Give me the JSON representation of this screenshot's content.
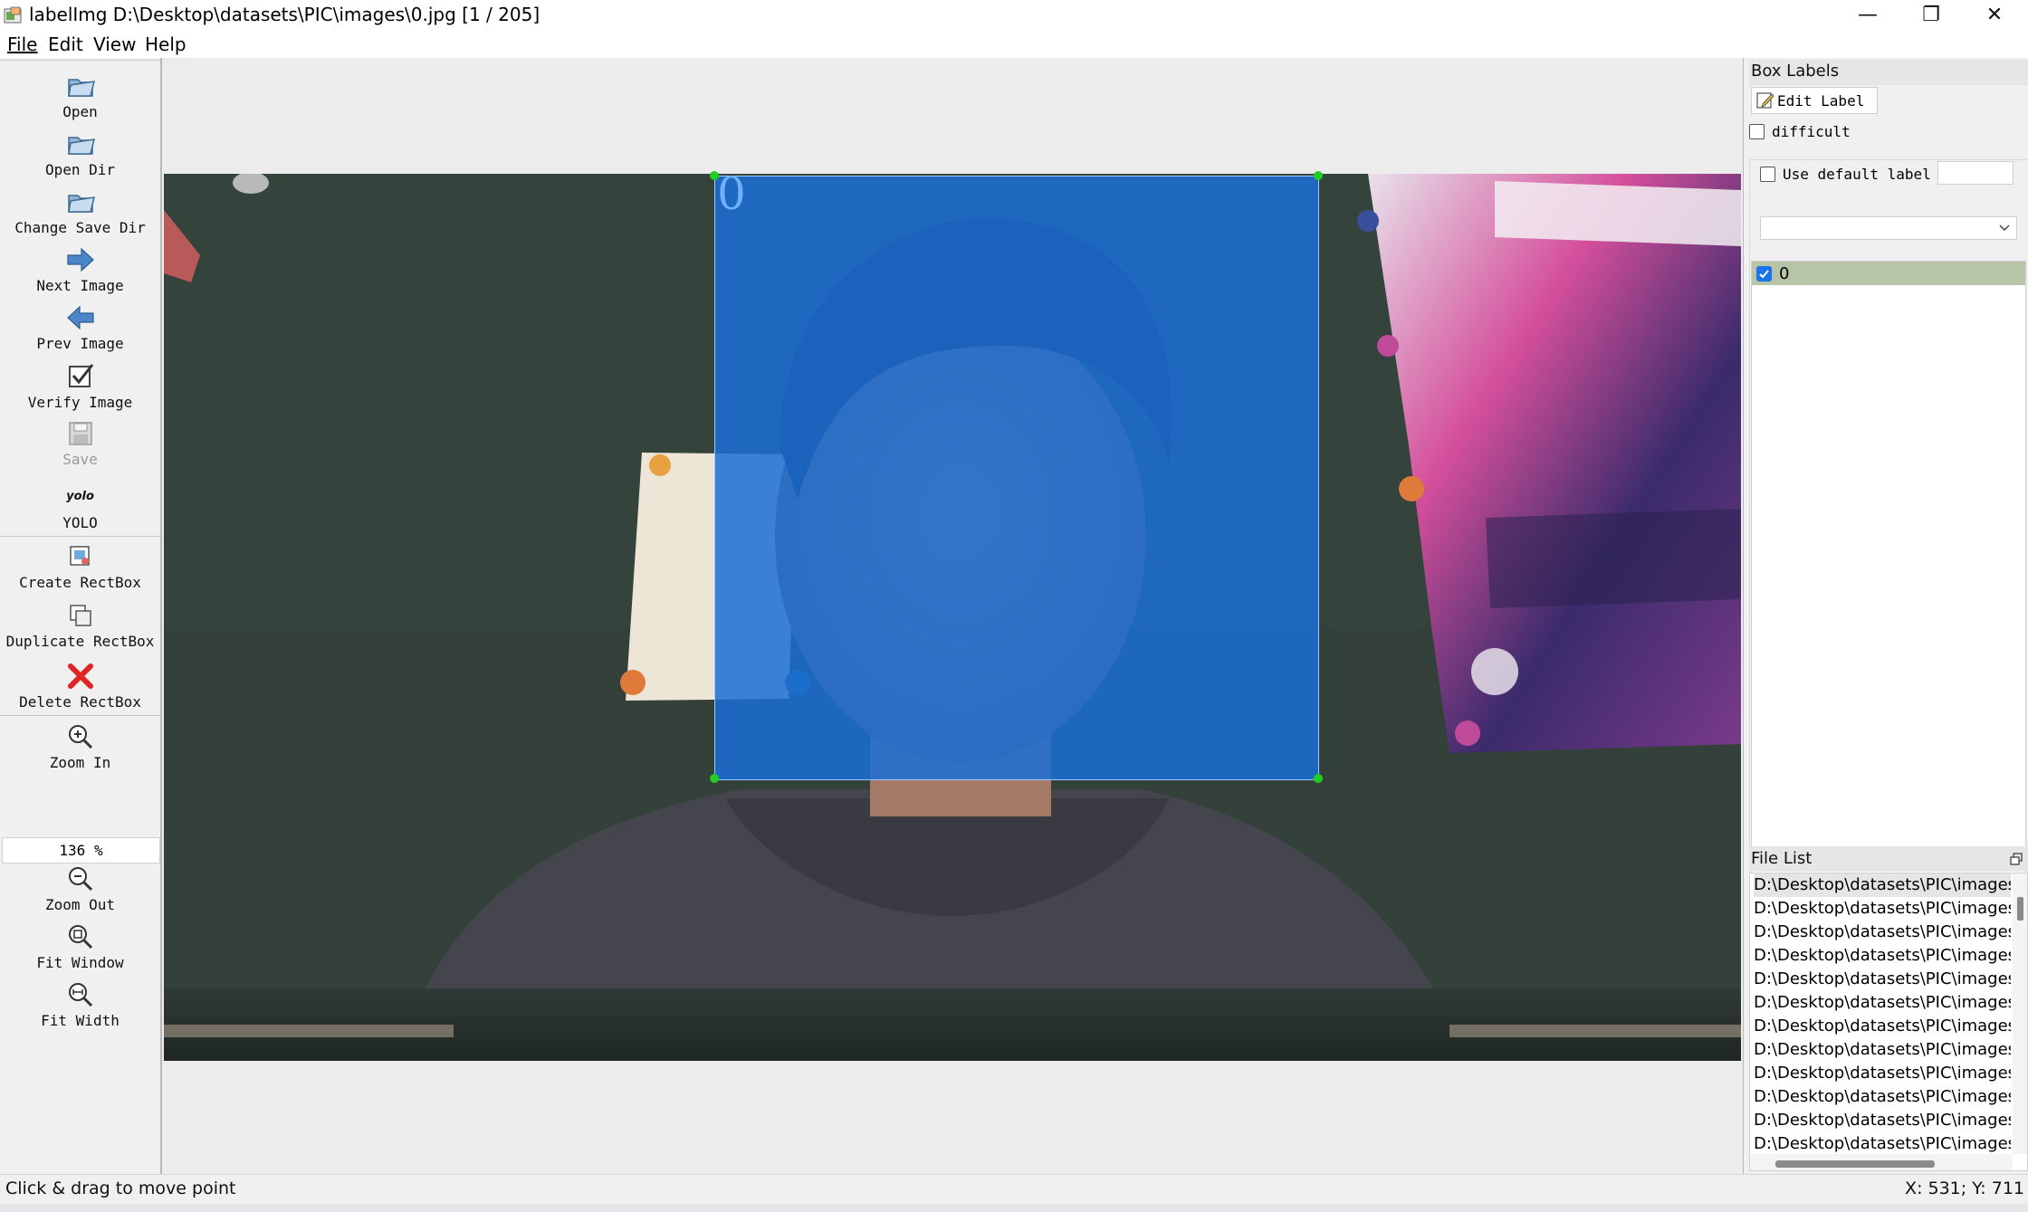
{
  "window": {
    "title": "labelImg D:\\Desktop\\datasets\\PIC\\images\\0.jpg [1 / 205]",
    "minimize_glyph": "—",
    "restore_glyph": "❐",
    "close_glyph": "✕"
  },
  "menu": {
    "items": [
      {
        "label": "File"
      },
      {
        "label": "Edit"
      },
      {
        "label": "View"
      },
      {
        "label": "Help"
      }
    ]
  },
  "toolbar": {
    "open": "Open",
    "open_dir": "Open Dir",
    "change_save_dir": "Change Save Dir",
    "next_image": "Next Image",
    "prev_image": "Prev Image",
    "verify_image": "Verify Image",
    "save": "Save",
    "format_icon_text": "yolo",
    "format": "YOLO",
    "create_rectbox": "Create RectBox",
    "duplicate_rectbox": "Duplicate RectBox",
    "delete_rectbox": "Delete RectBox",
    "zoom_in": "Zoom In",
    "zoom_value": "136 %",
    "zoom_out": "Zoom Out",
    "fit_window": "Fit Window",
    "fit_width": "Fit Width"
  },
  "canvas": {
    "box_label": "0",
    "box_color": "#1a6fd6",
    "handle_color": "#22cc22"
  },
  "box_labels_panel": {
    "title": "Box Labels",
    "edit_label": "Edit Label",
    "difficult": "difficult",
    "difficult_checked": false,
    "use_default_label": "Use default label",
    "use_default_checked": false,
    "default_label_value": "",
    "dropdown_value": "",
    "labels": [
      {
        "text": "0",
        "checked": true
      }
    ]
  },
  "file_list_panel": {
    "title": "File List",
    "files": [
      "D:\\Desktop\\datasets\\PIC\\images",
      "D:\\Desktop\\datasets\\PIC\\images",
      "D:\\Desktop\\datasets\\PIC\\images",
      "D:\\Desktop\\datasets\\PIC\\images",
      "D:\\Desktop\\datasets\\PIC\\images",
      "D:\\Desktop\\datasets\\PIC\\images",
      "D:\\Desktop\\datasets\\PIC\\images",
      "D:\\Desktop\\datasets\\PIC\\images",
      "D:\\Desktop\\datasets\\PIC\\images",
      "D:\\Desktop\\datasets\\PIC\\images",
      "D:\\Desktop\\datasets\\PIC\\images",
      "D:\\Desktop\\datasets\\PIC\\images"
    ]
  },
  "status": {
    "message": "Click & drag to move point",
    "coords": "X: 531; Y: 711"
  }
}
